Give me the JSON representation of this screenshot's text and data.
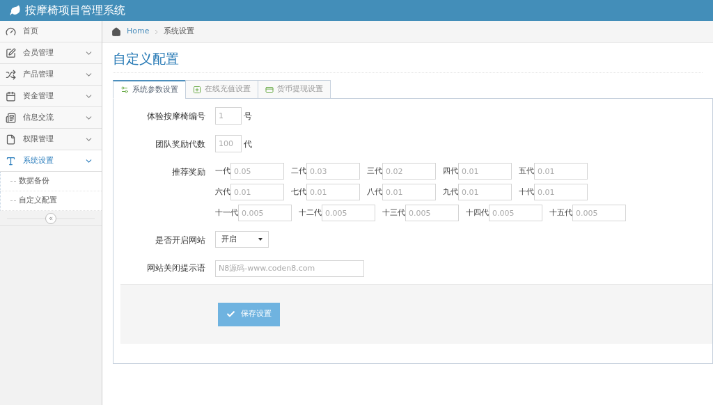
{
  "header": {
    "title": "按摩椅项目管理系统"
  },
  "sidebar": {
    "items": [
      {
        "label": "首页",
        "selected": false
      },
      {
        "label": "会员管理",
        "selected": false,
        "expanded": false
      },
      {
        "label": "产品管理",
        "selected": false,
        "expanded": false
      },
      {
        "label": "资金管理",
        "selected": false,
        "expanded": false
      },
      {
        "label": "信息交流",
        "selected": false,
        "expanded": false
      },
      {
        "label": "权限管理",
        "selected": false,
        "expanded": false
      },
      {
        "label": "系统设置",
        "selected": true,
        "expanded": true,
        "children": [
          {
            "label": "数据备份"
          },
          {
            "label": "自定义配置"
          }
        ]
      }
    ],
    "collapse": "«"
  },
  "breadcrumb": [
    "Home",
    "系统设置"
  ],
  "page_title": "自定义配置",
  "tabs": [
    {
      "label": "系统参数设置",
      "selected": true
    },
    {
      "label": "在线充值设置",
      "selected": false
    },
    {
      "label": "货币提现设置",
      "selected": false
    }
  ],
  "form": {
    "trial_chair": {
      "label": "体验按摩椅编号",
      "placeholder": "1",
      "suffix": "号"
    },
    "team_levels": {
      "label": "团队奖励代数",
      "placeholder": "100",
      "suffix": "代"
    },
    "referral": {
      "label": "推荐奖励",
      "rows": [
        [
          {
            "label": "一代",
            "placeholder": "0.05"
          },
          {
            "label": "二代",
            "placeholder": "0.03"
          },
          {
            "label": "三代",
            "placeholder": "0.02"
          },
          {
            "label": "四代",
            "placeholder": "0.01"
          },
          {
            "label": "五代",
            "placeholder": "0.01"
          }
        ],
        [
          {
            "label": "六代",
            "placeholder": "0.01"
          },
          {
            "label": "七代",
            "placeholder": "0.01"
          },
          {
            "label": "八代",
            "placeholder": "0.01"
          },
          {
            "label": "九代",
            "placeholder": "0.01"
          },
          {
            "label": "十代",
            "placeholder": "0.01"
          }
        ],
        [
          {
            "label": "十一代",
            "placeholder": "0.005"
          },
          {
            "label": "十二代",
            "placeholder": "0.005"
          },
          {
            "label": "十三代",
            "placeholder": "0.005"
          },
          {
            "label": "十四代",
            "placeholder": "0.005"
          },
          {
            "label": "十五代",
            "placeholder": "0.005"
          }
        ]
      ]
    },
    "site_open": {
      "label": "是否开启网站",
      "value": "开启"
    },
    "close_message": {
      "label": "网站关闭提示语",
      "placeholder": "N8源码-www.coden8.com"
    },
    "save": "保存设置"
  }
}
